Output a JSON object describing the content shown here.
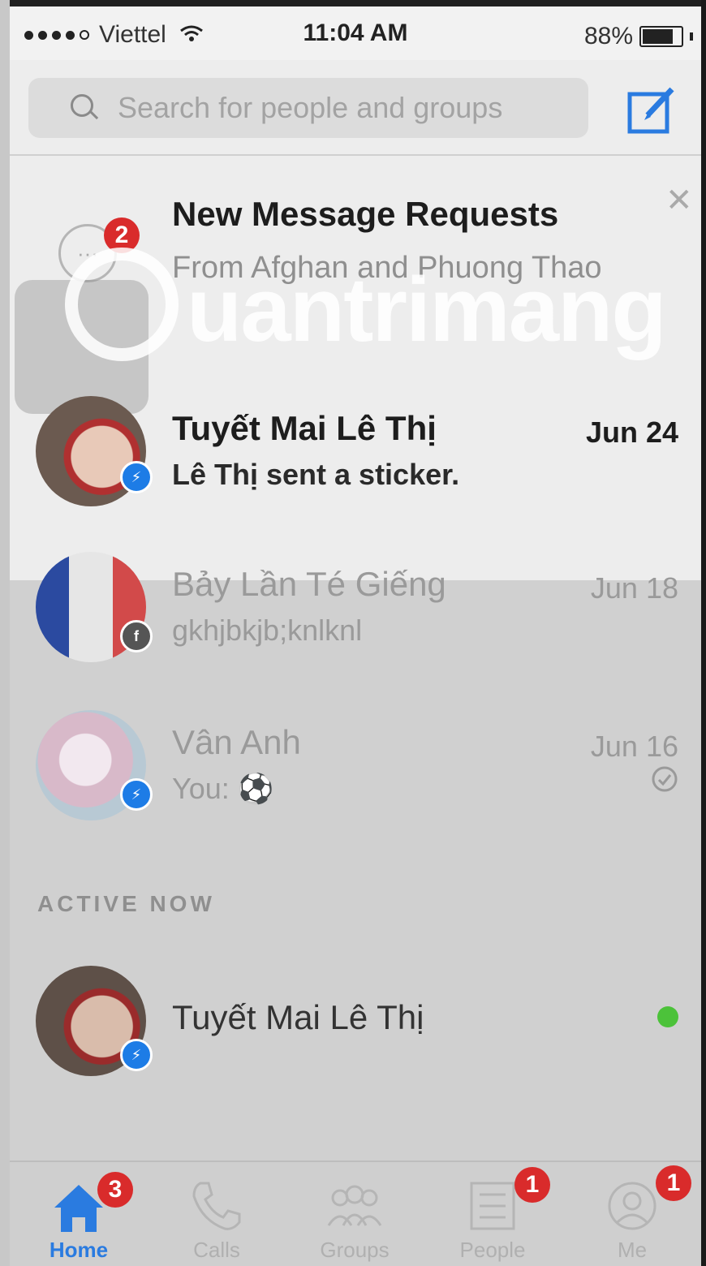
{
  "status_bar": {
    "carrier": "Viettel",
    "time": "11:04 AM",
    "battery": "88%",
    "battery_level": 0.88
  },
  "search": {
    "placeholder": "Search for people and groups"
  },
  "message_requests": {
    "title": "New Message Requests",
    "subtitle": "From Afghan and Phuong Thao",
    "badge": "2"
  },
  "watermark": {
    "text": "uantrimang"
  },
  "conversations": [
    {
      "name": "Tuyết Mai Lê Thị",
      "message": "Lê Thị sent a sticker.",
      "date": "Jun 24",
      "unread": true,
      "badge_icon": "messenger-icon"
    },
    {
      "name": "Bảy Lần Té Giếng",
      "message": "gkhjbkjb;knlknl",
      "date": "Jun 18",
      "unread": false,
      "badge_icon": "facebook-icon"
    },
    {
      "name": "Vân Anh",
      "message": "You: ⚽",
      "date": "Jun 16",
      "unread": false,
      "badge_icon": "messenger-icon",
      "status_icon": "sent-check-icon"
    }
  ],
  "active_now": {
    "label": "ACTIVE NOW",
    "contacts": [
      {
        "name": "Tuyết Mai Lê Thị",
        "online_color": "#4cc23a"
      }
    ]
  },
  "tab_bar": {
    "tabs": [
      {
        "label": "Home",
        "badge": "3",
        "active": true,
        "icon": "home-icon"
      },
      {
        "label": "Calls",
        "badge": "",
        "active": false,
        "icon": "phone-icon"
      },
      {
        "label": "Groups",
        "badge": "",
        "active": false,
        "icon": "groups-icon"
      },
      {
        "label": "People",
        "badge": "1",
        "active": false,
        "icon": "people-list-icon"
      },
      {
        "label": "Me",
        "badge": "1",
        "active": false,
        "icon": "profile-icon"
      }
    ]
  },
  "colors": {
    "accent": "#2a7be0",
    "badge": "#d92b2b",
    "online": "#4cc23a"
  }
}
